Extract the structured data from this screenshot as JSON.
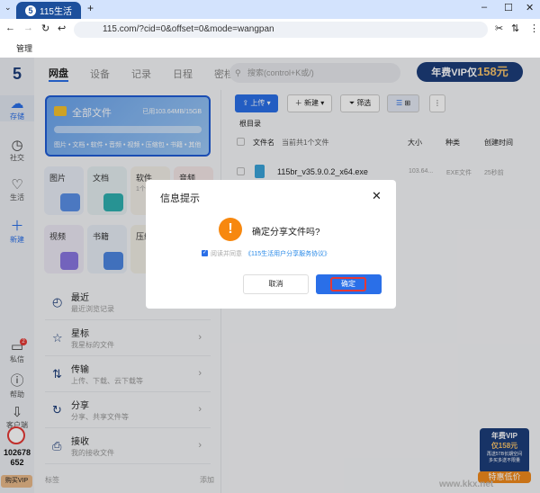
{
  "browser": {
    "tab_title": "115生活",
    "url": "115.com/?cid=0&offset=0&mode=wangpan",
    "bookmark": "管理"
  },
  "rail": {
    "items": [
      {
        "label": "存储",
        "icon": "cloud-icon"
      },
      {
        "label": "社交",
        "icon": "clock-icon"
      },
      {
        "label": "生活",
        "icon": "heart-icon"
      },
      {
        "label": "新建",
        "icon": "plus-icon"
      },
      {
        "label": "私信",
        "icon": "message-icon",
        "badge": "2"
      },
      {
        "label": "帮助",
        "icon": "help-icon"
      },
      {
        "label": "客户端",
        "icon": "download-icon"
      }
    ],
    "user_id": "102678652",
    "buy_vip": "购买VIP"
  },
  "nav": {
    "tabs": [
      "网盘",
      "设备",
      "记录",
      "日程",
      "密档"
    ],
    "search_placeholder": "搜索(control+K或/)",
    "vip_text": "年费VIP仅",
    "vip_price": "158元"
  },
  "all_files": {
    "title": "全部文件",
    "usage": "已用103.64MB/15GB",
    "types": "图片 • 文档 • 软件 • 音频 • 视频 • 压缩包 • 书籍 • 其他"
  },
  "tiles": [
    {
      "label": "图片"
    },
    {
      "label": "文档"
    },
    {
      "label": "软件",
      "sub": "1个"
    },
    {
      "label": "音频"
    },
    {
      "label": "视频"
    },
    {
      "label": "书籍"
    },
    {
      "label": "压缩"
    }
  ],
  "list": [
    {
      "title": "最近",
      "sub": "最近浏览记录"
    },
    {
      "title": "星标",
      "sub": "我星标的文件"
    },
    {
      "title": "传输",
      "sub": "上传、下载、云下载等"
    },
    {
      "title": "分享",
      "sub": "分享、共享文件等"
    },
    {
      "title": "接收",
      "sub": "我的接收文件"
    }
  ],
  "tags": {
    "label": "标签",
    "add": "添加"
  },
  "toolbar": {
    "upload": "上传",
    "new": "新建",
    "filter": "筛选"
  },
  "breadcrumb": "根目录",
  "table": {
    "headers": [
      "文件名",
      "当前共1个文件",
      "大小",
      "种类",
      "创建时间"
    ],
    "rows": [
      {
        "name": "115br_v35.9.0.2_x64.exe",
        "size": "103.64...",
        "type": "EXE文件",
        "time": "25秒前"
      }
    ]
  },
  "promo": {
    "line1": "年费VIP",
    "line2": "仅158元",
    "line3": "再送5TB长期空间",
    "line4": "多买多送不限量",
    "cta": "特惠低价"
  },
  "watermark": "www.kkx.net",
  "modal": {
    "title": "信息提示",
    "message": "确定分享文件吗?",
    "agree_prefix": "阅读并同意",
    "agree_link": "《115生活用户分享服务协议》",
    "agree_checked": true,
    "cancel": "取消",
    "confirm": "确定"
  },
  "colors": {
    "accent": "#2a6fe8",
    "warning": "#f7880f",
    "highlight": "#e53935"
  }
}
